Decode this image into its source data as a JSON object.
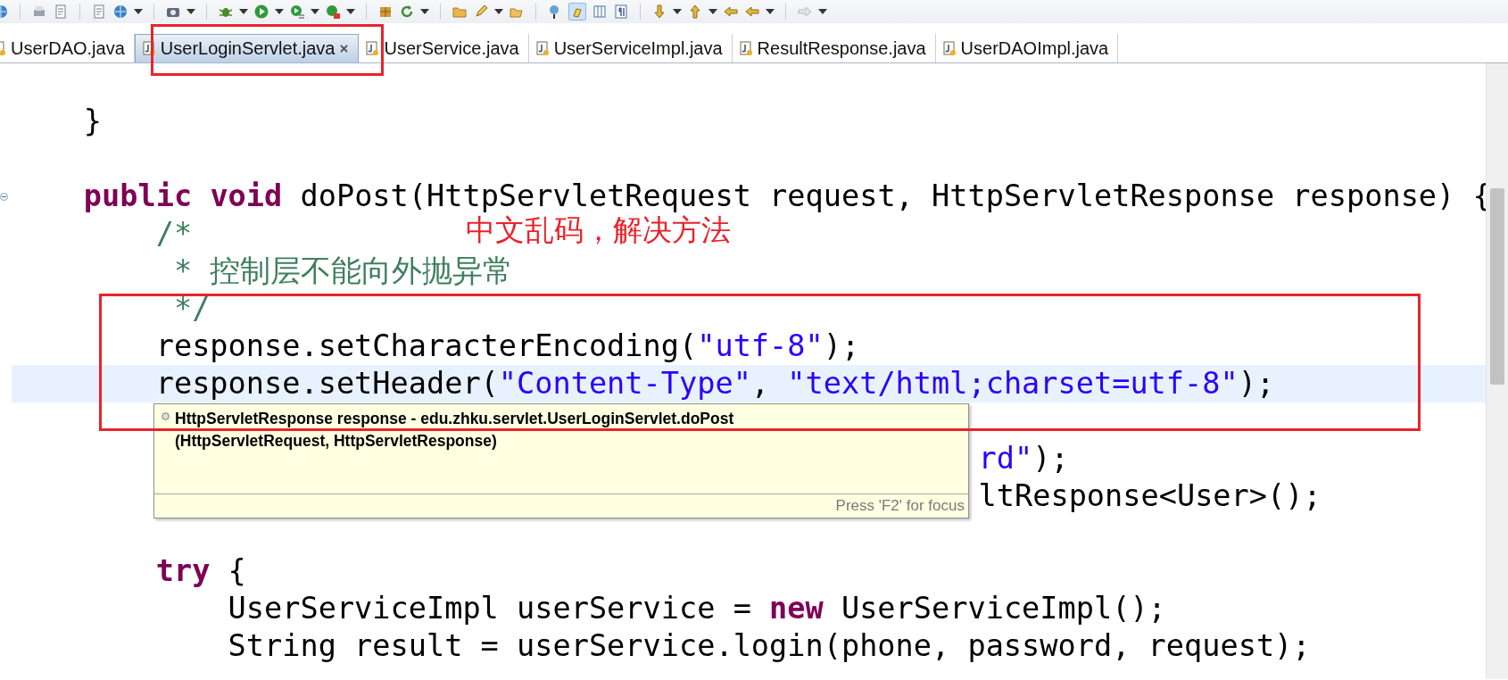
{
  "tabs": [
    {
      "label": "UserDAO.java",
      "selected": false
    },
    {
      "label": "UserLoginServlet.java",
      "selected": true
    },
    {
      "label": "UserService.java",
      "selected": false
    },
    {
      "label": "UserServiceImpl.java",
      "selected": false
    },
    {
      "label": "ResultResponse.java",
      "selected": false
    },
    {
      "label": "UserDAOImpl.java",
      "selected": false
    }
  ],
  "editor": {
    "lines": [
      {
        "kind": "blank"
      },
      {
        "kind": "code",
        "tokens": [
          {
            "kind": "plain",
            "text": "    }"
          }
        ]
      },
      {
        "kind": "blank"
      },
      {
        "kind": "foldable",
        "tokens": [
          {
            "kind": "keyword",
            "text": "    public"
          },
          {
            "kind": "keyword",
            "text": " void"
          },
          {
            "kind": "plain",
            "text": " doPost(HttpServletRequest request, HttpServletResponse response) {"
          }
        ]
      },
      {
        "kind": "code",
        "tokens": [
          {
            "kind": "comment",
            "text": "        /*"
          }
        ]
      },
      {
        "kind": "code",
        "tokens": [
          {
            "kind": "comment",
            "text": "         * 控制层不能向外抛异常"
          }
        ]
      },
      {
        "kind": "code",
        "tokens": [
          {
            "kind": "comment",
            "text": "         */"
          }
        ]
      },
      {
        "kind": "code",
        "tokens": [
          {
            "kind": "plain",
            "text": "        response.setCharacterEncoding("
          },
          {
            "kind": "string",
            "text": "\"utf-8\""
          },
          {
            "kind": "plain",
            "text": ");"
          }
        ]
      },
      {
        "kind": "code",
        "current": true,
        "tokens": [
          {
            "kind": "plain",
            "text": "        response.setHeader("
          },
          {
            "kind": "string",
            "text": "\"Content-Type\""
          },
          {
            "kind": "plain",
            "text": ", "
          },
          {
            "kind": "string",
            "text": "\"text/html;charset=utf-8\""
          },
          {
            "kind": "plain",
            "text": ");"
          }
        ]
      },
      {
        "kind": "blank"
      },
      {
        "kind": "partial",
        "tokens": [
          {
            "kind": "string",
            "text": "rd\""
          },
          {
            "kind": "plain",
            "text": ");"
          }
        ]
      },
      {
        "kind": "partial",
        "tokens": [
          {
            "kind": "plain",
            "text": "ltResponse<User>();"
          }
        ]
      },
      {
        "kind": "blank"
      },
      {
        "kind": "code",
        "tokens": [
          {
            "kind": "keyword",
            "text": "        try"
          },
          {
            "kind": "plain",
            "text": " {"
          }
        ]
      },
      {
        "kind": "code",
        "tokens": [
          {
            "kind": "plain",
            "text": "            UserServiceImpl userService = "
          },
          {
            "kind": "keyword",
            "text": "new"
          },
          {
            "kind": "plain",
            "text": " UserServiceImpl();"
          }
        ]
      },
      {
        "kind": "code",
        "tokens": [
          {
            "kind": "plain",
            "text": "            String result = userService.login(phone, password, request);"
          }
        ]
      }
    ],
    "tooltip": {
      "lines": [
        "HttpServletResponse response - edu.zhku.servlet.UserLoginServlet.doPost",
        "(HttpServletRequest, HttpServletResponse)"
      ],
      "footer": "Press 'F2' for focus"
    },
    "note": "中文乱码，解决方法"
  }
}
